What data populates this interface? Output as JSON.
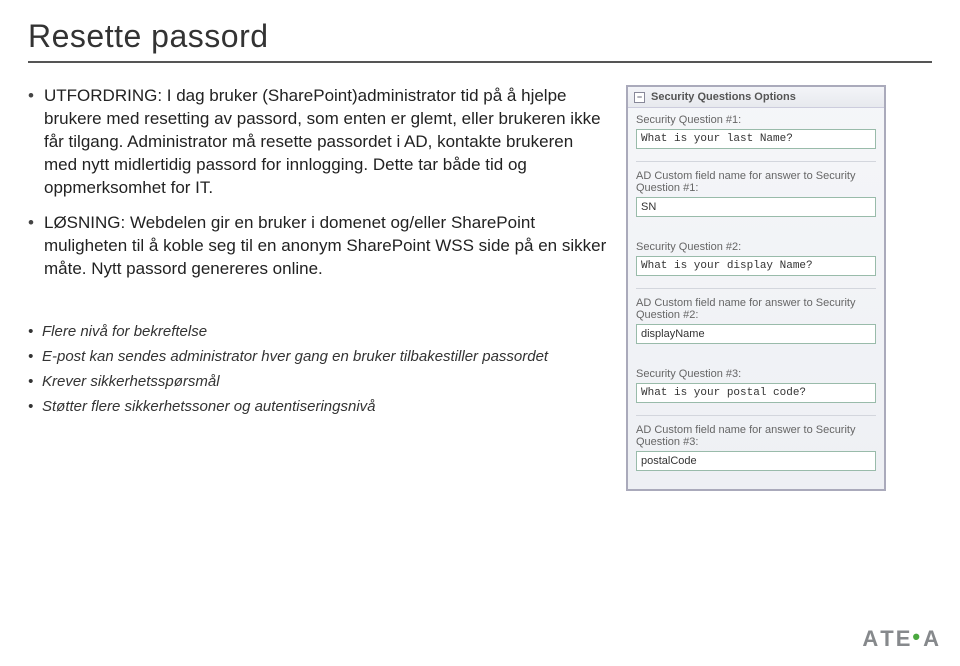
{
  "title": "Resette passord",
  "bullets": [
    "UTFORDRING: I dag bruker (SharePoint)administrator tid på å hjelpe brukere med resetting av passord, som enten er glemt, eller brukeren ikke får tilgang. Administrator må resette passordet i AD, kontakte brukeren med nytt midlertidig passord for innlogging. Dette tar både tid og oppmerksomhet for IT.",
    "LØSNING: Webdelen gir en bruker i domenet og/eller SharePoint muligheten til å koble seg til en anonym SharePoint WSS side på en sikker måte. Nytt passord genereres online."
  ],
  "subbullets": [
    "Flere nivå for bekreftelse",
    "E-post kan sendes administrator hver gang en bruker tilbakestiller passordet",
    "Krever sikkerhetsspørsmål",
    "Støtter flere sikkerhetssoner og autentiseringsnivå"
  ],
  "panel": {
    "header": "Security Questions Options",
    "collapse_glyph": "−",
    "groups": [
      {
        "qlabel": "Security Question #1:",
        "qval": "What is your last Name?",
        "dlabel": "AD Custom field name for answer to Security Question #1:",
        "dval": "SN"
      },
      {
        "qlabel": "Security Question #2:",
        "qval": "What is your display Name?",
        "dlabel": "AD Custom field name for answer to Security Question #2:",
        "dval": "displayName"
      },
      {
        "qlabel": "Security Question #3:",
        "qval": "What is your postal code?",
        "dlabel": "AD Custom field name for answer to Security Question #3:",
        "dval": "postalCode"
      }
    ]
  },
  "logo": {
    "part1": "A",
    "part2": "T",
    "part3": "E",
    "dot": "•",
    "part4": "A"
  }
}
